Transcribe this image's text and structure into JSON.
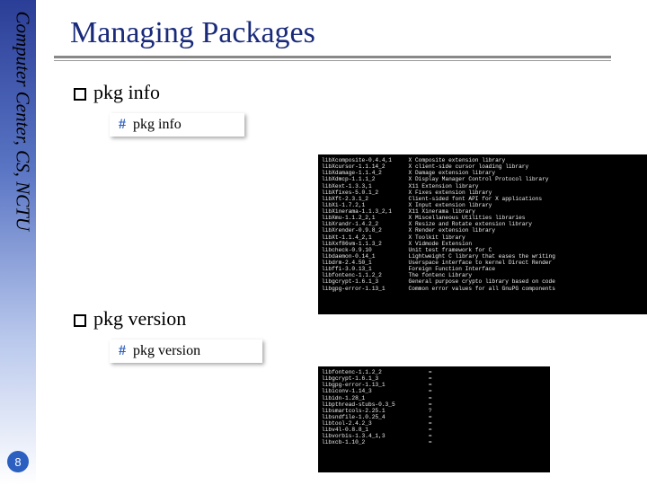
{
  "sidebar": {
    "org": "Computer Center, CS, NCTU"
  },
  "page_number": "8",
  "title": "Managing Packages",
  "sections": [
    {
      "bullet": "pkg info",
      "command_prefix": "#",
      "command": "pkg info"
    },
    {
      "bullet": "pkg version",
      "command_prefix": "#",
      "command": "pkg version"
    }
  ],
  "terminals": {
    "pkg_info_rows": [
      [
        "libXcomposite-0.4.4,1",
        "X Composite extension library"
      ],
      [
        "libXcursor-1.1.14_2",
        "X client-side cursor loading library"
      ],
      [
        "libXdamage-1.1.4_2",
        "X Damage extension library"
      ],
      [
        "libXdmcp-1.1.1_2",
        "X Display Manager Control Protocol library"
      ],
      [
        "libXext-1.3.3,1",
        "X11 Extension library"
      ],
      [
        "libXfixes-5.0.1_2",
        "X Fixes extension library"
      ],
      [
        "libXft-2.3.1_2",
        "Client-sided font API for X applications"
      ],
      [
        "libXi-1.7.2,1",
        "X Input extension library"
      ],
      [
        "libXinerama-1.1.3_2,1",
        "X11 Xinerama library"
      ],
      [
        "libXmu-1.1.2_2,1",
        "X Miscellaneous Utilities libraries"
      ],
      [
        "libXrandr-1.4.2_2",
        "X Resize and Rotate extension library"
      ],
      [
        "libXrender-0.9.8_2",
        "X Render extension library"
      ],
      [
        "libXt-1.1.4_2,1",
        "X Toolkit library"
      ],
      [
        "libXxf86vm-1.1.3_2",
        "X Vidmode Extension"
      ],
      [
        "libcheck-0.9.10",
        "Unit test framework for C"
      ],
      [
        "libdaemon-0.14_1",
        "Lightweight C library that eases the writing"
      ],
      [
        "libdrm-2.4.50_1",
        "Userspace interface to kernel Direct Render"
      ],
      [
        "libffi-3.0.13_1",
        "Foreign Function Interface"
      ],
      [
        "libfontenc-1.1.2_2",
        "The fontenc Library"
      ],
      [
        "libgcrypt-1.6.1_3",
        "General purpose crypto library based on code"
      ],
      [
        "libgpg-error-1.13_1",
        "Common error values for all GnuPG components"
      ]
    ],
    "pkg_version_rows": [
      [
        "libfontenc-1.1.2_2",
        "="
      ],
      [
        "libgcrypt-1.6.1_3",
        "="
      ],
      [
        "libgpg-error-1.13_1",
        "="
      ],
      [
        "libiconv-1.14_3",
        "="
      ],
      [
        "libidn-1.28_1",
        "="
      ],
      [
        "libpthread-stubs-0.3_5",
        "="
      ],
      [
        "libsmartcols-2.25.1",
        "?"
      ],
      [
        "libsndfile-1.0.25_4",
        "="
      ],
      [
        "libtool-2.4.2_3",
        "="
      ],
      [
        "libv4l-0.8.8_1",
        "="
      ],
      [
        "libvorbis-1.3.4_1,3",
        "="
      ],
      [
        "libxcb-1.10_2",
        "="
      ]
    ]
  }
}
